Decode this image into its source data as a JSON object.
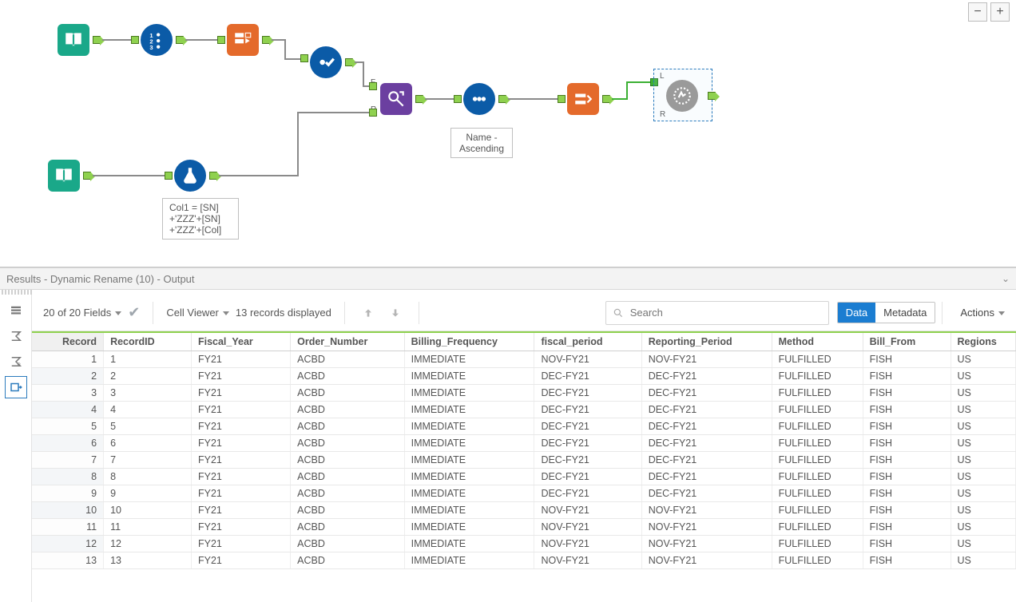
{
  "canvas": {
    "zoom_out_label": "−",
    "zoom_in_label": "+",
    "sort_note_line1": "Name -",
    "sort_note_line2": "Ascending",
    "formula_note_line1": "Col1 = [SN]",
    "formula_note_line2": "+'ZZZ'+[SN]",
    "formula_note_line3": "+'ZZZ'+[Col]",
    "anchor_F": "F",
    "anchor_R": "R",
    "anchor_L": "L"
  },
  "results": {
    "title": "Results - Dynamic Rename (10) - Output",
    "fields_label": "20 of 20 Fields",
    "cell_viewer_label": "Cell Viewer",
    "records_label": "13 records displayed",
    "search_placeholder": "Search",
    "tab_data": "Data",
    "tab_metadata": "Metadata",
    "actions_label": "Actions"
  },
  "table": {
    "columns": [
      "Record",
      "RecordID",
      "Fiscal_Year",
      "Order_Number",
      "Billing_Frequency",
      "fiscal_period",
      "Reporting_Period",
      "Method",
      "Bill_From",
      "Regions"
    ],
    "rows": [
      [
        "1",
        "1",
        "FY21",
        "ACBD",
        "IMMEDIATE",
        "NOV-FY21",
        "NOV-FY21",
        "FULFILLED",
        "FISH",
        "US"
      ],
      [
        "2",
        "2",
        "FY21",
        "ACBD",
        "IMMEDIATE",
        "DEC-FY21",
        "DEC-FY21",
        "FULFILLED",
        "FISH",
        "US"
      ],
      [
        "3",
        "3",
        "FY21",
        "ACBD",
        "IMMEDIATE",
        "DEC-FY21",
        "DEC-FY21",
        "FULFILLED",
        "FISH",
        "US"
      ],
      [
        "4",
        "4",
        "FY21",
        "ACBD",
        "IMMEDIATE",
        "DEC-FY21",
        "DEC-FY21",
        "FULFILLED",
        "FISH",
        "US"
      ],
      [
        "5",
        "5",
        "FY21",
        "ACBD",
        "IMMEDIATE",
        "DEC-FY21",
        "DEC-FY21",
        "FULFILLED",
        "FISH",
        "US"
      ],
      [
        "6",
        "6",
        "FY21",
        "ACBD",
        "IMMEDIATE",
        "DEC-FY21",
        "DEC-FY21",
        "FULFILLED",
        "FISH",
        "US"
      ],
      [
        "7",
        "7",
        "FY21",
        "ACBD",
        "IMMEDIATE",
        "DEC-FY21",
        "DEC-FY21",
        "FULFILLED",
        "FISH",
        "US"
      ],
      [
        "8",
        "8",
        "FY21",
        "ACBD",
        "IMMEDIATE",
        "DEC-FY21",
        "DEC-FY21",
        "FULFILLED",
        "FISH",
        "US"
      ],
      [
        "9",
        "9",
        "FY21",
        "ACBD",
        "IMMEDIATE",
        "DEC-FY21",
        "DEC-FY21",
        "FULFILLED",
        "FISH",
        "US"
      ],
      [
        "10",
        "10",
        "FY21",
        "ACBD",
        "IMMEDIATE",
        "NOV-FY21",
        "NOV-FY21",
        "FULFILLED",
        "FISH",
        "US"
      ],
      [
        "11",
        "11",
        "FY21",
        "ACBD",
        "IMMEDIATE",
        "NOV-FY21",
        "NOV-FY21",
        "FULFILLED",
        "FISH",
        "US"
      ],
      [
        "12",
        "12",
        "FY21",
        "ACBD",
        "IMMEDIATE",
        "NOV-FY21",
        "NOV-FY21",
        "FULFILLED",
        "FISH",
        "US"
      ],
      [
        "13",
        "13",
        "FY21",
        "ACBD",
        "IMMEDIATE",
        "NOV-FY21",
        "NOV-FY21",
        "FULFILLED",
        "FISH",
        "US"
      ]
    ]
  }
}
